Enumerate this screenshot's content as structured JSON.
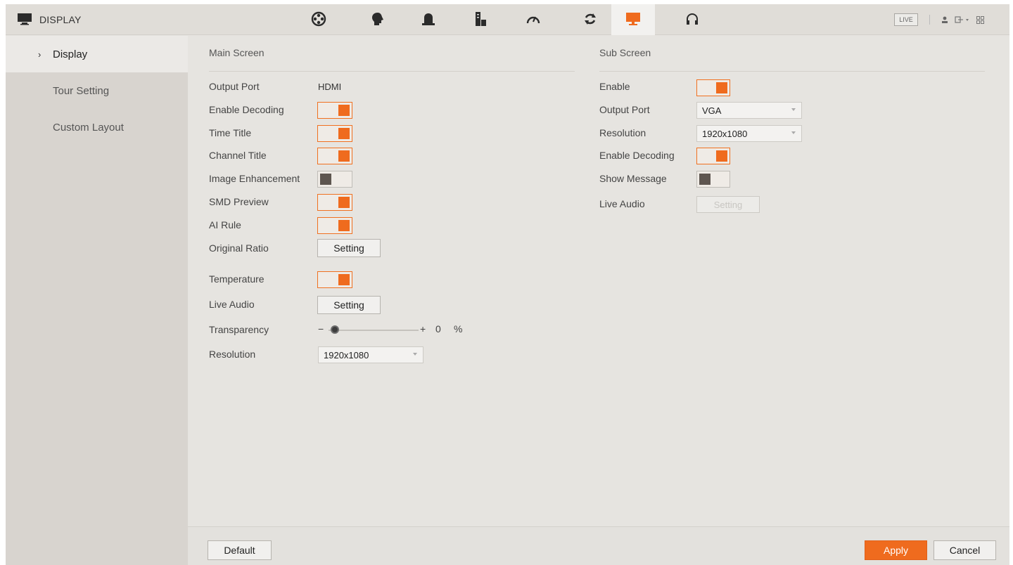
{
  "header": {
    "title": "DISPLAY",
    "live_label": "LIVE",
    "tabs": [
      {
        "icon": "film-reel-icon"
      },
      {
        "icon": "brain-icon"
      },
      {
        "icon": "alarm-bell-icon"
      },
      {
        "icon": "storage-icon"
      },
      {
        "icon": "gauge-icon"
      },
      {
        "icon": "refresh-icon"
      },
      {
        "icon": "monitor-icon",
        "active": true
      },
      {
        "icon": "headphones-icon"
      }
    ],
    "accent_color": "#ef6b1e"
  },
  "sidebar": {
    "items": [
      {
        "label": "Display",
        "active": true
      },
      {
        "label": "Tour Setting"
      },
      {
        "label": "Custom Layout"
      }
    ]
  },
  "main_screen": {
    "title": "Main Screen",
    "output_port_label": "Output Port",
    "output_port_value": "HDMI",
    "enable_decoding_label": "Enable Decoding",
    "enable_decoding": true,
    "time_title_label": "Time Title",
    "time_title": true,
    "channel_title_label": "Channel Title",
    "channel_title": true,
    "image_enhancement_label": "Image Enhancement",
    "image_enhancement": false,
    "smd_preview_label": "SMD Preview",
    "smd_preview": true,
    "ai_rule_label": "AI Rule",
    "ai_rule": true,
    "original_ratio_label": "Original Ratio",
    "original_ratio_button": "Setting",
    "temperature_label": "Temperature",
    "temperature": true,
    "live_audio_label": "Live Audio",
    "live_audio_button": "Setting",
    "transparency_label": "Transparency",
    "transparency_minus": "−",
    "transparency_plus": "+",
    "transparency_value": "0",
    "transparency_unit": "%",
    "resolution_label": "Resolution",
    "resolution_value": "1920x1080"
  },
  "sub_screen": {
    "title": "Sub Screen",
    "enable_label": "Enable",
    "enable": true,
    "output_port_label": "Output Port",
    "output_port_value": "VGA",
    "resolution_label": "Resolution",
    "resolution_value": "1920x1080",
    "enable_decoding_label": "Enable Decoding",
    "enable_decoding": true,
    "show_message_label": "Show Message",
    "show_message": false,
    "live_audio_label": "Live Audio",
    "live_audio_button": "Setting"
  },
  "footer": {
    "default_label": "Default",
    "apply_label": "Apply",
    "cancel_label": "Cancel"
  }
}
